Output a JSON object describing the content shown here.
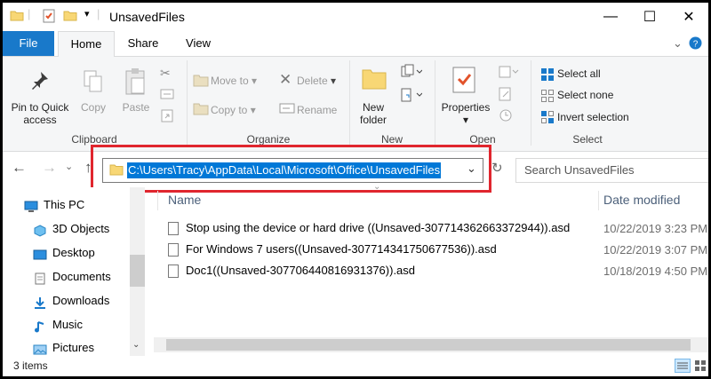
{
  "window": {
    "title": "UnsavedFiles",
    "minimize": "—",
    "maximize": "☐",
    "close": "✕"
  },
  "ribbon_tabs": {
    "file": "File",
    "home": "Home",
    "share": "Share",
    "view": "View"
  },
  "clipboard": {
    "pin": "Pin to Quick access",
    "copy": "Copy",
    "paste": "Paste",
    "label": "Clipboard"
  },
  "organize": {
    "move_to": "Move to",
    "copy_to": "Copy to",
    "delete": "Delete",
    "rename": "Rename",
    "label": "Organize"
  },
  "new_group": {
    "new_folder": "New folder",
    "label": "New"
  },
  "open_group": {
    "properties": "Properties",
    "label": "Open"
  },
  "select_group": {
    "select_all": "Select all",
    "select_none": "Select none",
    "invert_selection": "Invert selection",
    "label": "Select"
  },
  "address": {
    "path": "C:\\Users\\Tracy\\AppData\\Local\\Microsoft\\Office\\UnsavedFiles",
    "search_placeholder": "Search UnsavedFiles"
  },
  "nav_pane": {
    "items": [
      {
        "label": "This PC",
        "icon": "computer-icon"
      },
      {
        "label": "3D Objects",
        "icon": "cube-icon"
      },
      {
        "label": "Desktop",
        "icon": "desktop-icon"
      },
      {
        "label": "Documents",
        "icon": "documents-icon"
      },
      {
        "label": "Downloads",
        "icon": "download-icon"
      },
      {
        "label": "Music",
        "icon": "music-icon"
      },
      {
        "label": "Pictures",
        "icon": "pictures-icon"
      }
    ]
  },
  "file_list": {
    "columns": {
      "name": "Name",
      "date": "Date modified"
    },
    "rows": [
      {
        "name": "Stop using the device or hard drive ((Unsaved-307714362663372944)).asd",
        "date": "10/22/2019 3:23 PM"
      },
      {
        "name": "For Windows 7 users((Unsaved-307714341750677536)).asd",
        "date": "10/22/2019 3:07 PM"
      },
      {
        "name": "Doc1((Unsaved-307706440816931376)).asd",
        "date": "10/18/2019 4:50 PM"
      }
    ]
  },
  "status_bar": {
    "item_count": "3 items"
  },
  "colors": {
    "accent": "#1979ca",
    "selection": "#0078d7",
    "highlight_box": "#e0262e"
  }
}
